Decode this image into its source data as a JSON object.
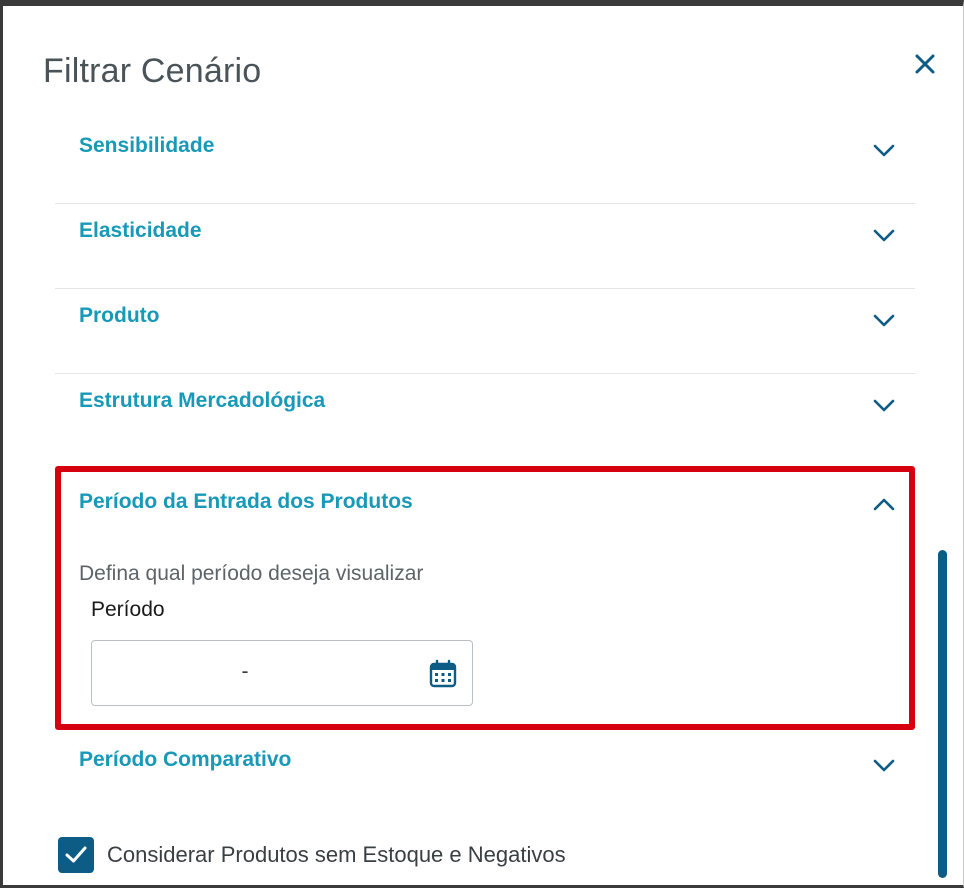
{
  "dialog": {
    "title": "Filtrar Cenário",
    "close_icon": "close-icon"
  },
  "sections": [
    {
      "label": "Sensibilidade",
      "expanded": false,
      "icon": "chevron-down-icon"
    },
    {
      "label": "Elasticidade",
      "expanded": false,
      "icon": "chevron-down-icon"
    },
    {
      "label": "Produto",
      "expanded": false,
      "icon": "chevron-down-icon"
    },
    {
      "label": "Estrutura Mercadológica",
      "expanded": false,
      "icon": "chevron-down-icon"
    }
  ],
  "expanded_section": {
    "label": "Período da Entrada dos Produtos",
    "expanded": true,
    "icon": "chevron-up-icon",
    "description": "Defina qual período deseja visualizar",
    "field_label": "Período",
    "field_value": "-",
    "field_icon": "calendar-icon"
  },
  "last_section": {
    "label": "Período Comparativo",
    "expanded": false,
    "icon": "chevron-down-icon"
  },
  "checkbox": {
    "label": "Considerar Produtos sem Estoque e Negativos",
    "checked": true
  },
  "colors": {
    "section_title": "#1899b7",
    "primary": "#0c5c86",
    "highlight_border": "#d6000f",
    "title_text": "#4a5458"
  }
}
